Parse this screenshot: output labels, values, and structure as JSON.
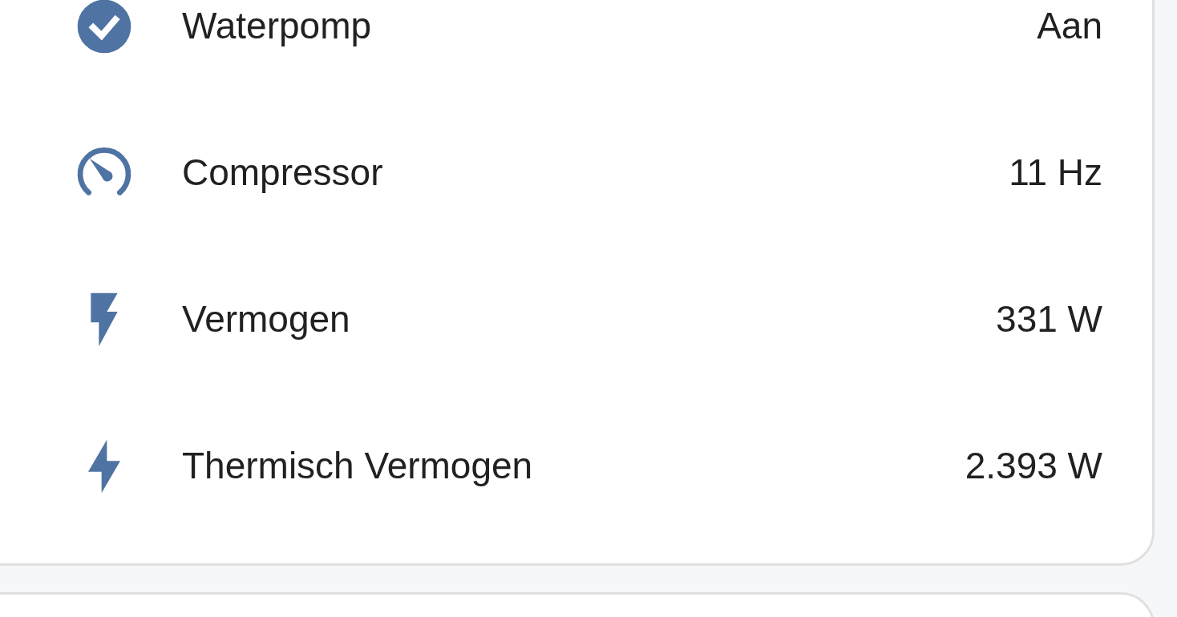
{
  "entities": [
    {
      "kind": "toggle",
      "name": "Waterpomp",
      "state": "Aan"
    },
    {
      "kind": "gauge",
      "name": "Compressor",
      "state": "11 Hz"
    },
    {
      "kind": "power",
      "name": "Vermogen",
      "state": "331 W"
    },
    {
      "kind": "energy",
      "name": "Thermisch Vermogen",
      "state": "2.393 W"
    }
  ]
}
